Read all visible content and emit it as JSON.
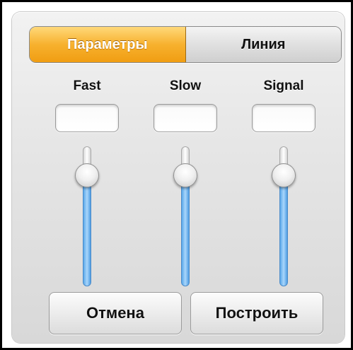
{
  "tabs": [
    {
      "label": "Параметры",
      "selected": true
    },
    {
      "label": "Линия",
      "selected": false
    }
  ],
  "columns": [
    {
      "label": "Fast",
      "value": "",
      "slider_level": 0.8
    },
    {
      "label": "Slow",
      "value": "",
      "slider_level": 0.8
    },
    {
      "label": "Signal",
      "value": "",
      "slider_level": 0.8
    }
  ],
  "buttons": {
    "cancel_label": "Отмена",
    "build_label": "Построить"
  },
  "colors": {
    "accent": "#f7b12e",
    "slider_fill": "#5aa8ea"
  }
}
